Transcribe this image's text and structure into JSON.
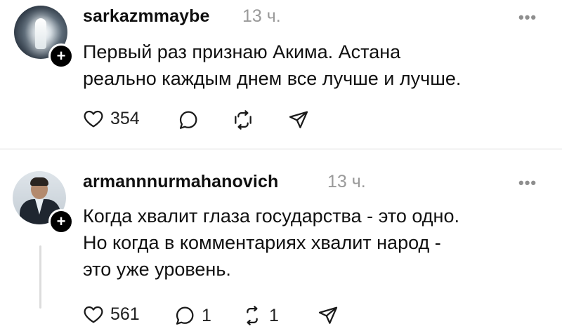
{
  "posts": [
    {
      "username": "sarkazmmaybe",
      "time": "13 ч.",
      "lines": [
        "Первый раз признаю Акима. Астана",
        "реально каждым днем все лучше и лучше."
      ],
      "likes": "354",
      "replies": "",
      "reposts": ""
    },
    {
      "username": "armannnurmahanovich",
      "time": "13 ч.",
      "lines": [
        "Когда хвалит глаза государства - это одно.",
        "Но когда в комментариях хвалит народ -",
        "это уже уровень."
      ],
      "likes": "561",
      "replies": "1",
      "reposts": "1"
    }
  ],
  "icons": {
    "more": "more-horizontal-icon",
    "like": "heart-icon",
    "reply": "comment-icon",
    "repost": "repost-icon",
    "share": "share-icon",
    "follow": "plus-icon"
  },
  "more_glyph": "•••",
  "plus_glyph": "+"
}
